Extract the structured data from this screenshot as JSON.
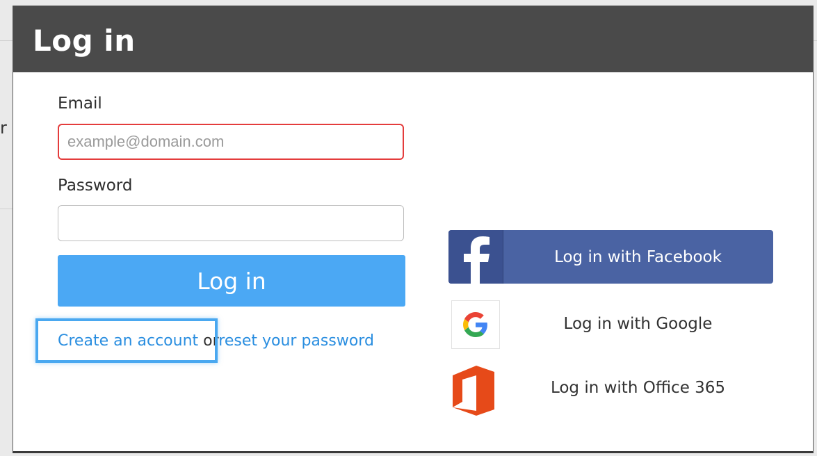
{
  "background": {
    "partial_glyph": "r"
  },
  "dialog": {
    "title": "Log in"
  },
  "form": {
    "email_label": "Email",
    "email_placeholder": "example@domain.com",
    "email_value": "",
    "password_label": "Password",
    "password_value": "",
    "submit_label": "Log in"
  },
  "links": {
    "create_account": "Create an account",
    "separator": "or",
    "reset_password": "reset your password"
  },
  "social": {
    "facebook_label": "Log in with Facebook",
    "google_label": "Log in with Google",
    "office_label": "Log in with Office 365"
  },
  "colors": {
    "header_bg": "#4a4a4a",
    "primary_button": "#4ba8f4",
    "link": "#2a8ee0",
    "error_border": "#e43c3c",
    "facebook": "#4a63a3",
    "office": "#e64a19",
    "highlight": "#4aa8f0"
  },
  "icons": {
    "facebook": "facebook-icon",
    "google": "google-icon",
    "office": "office-365-icon"
  }
}
